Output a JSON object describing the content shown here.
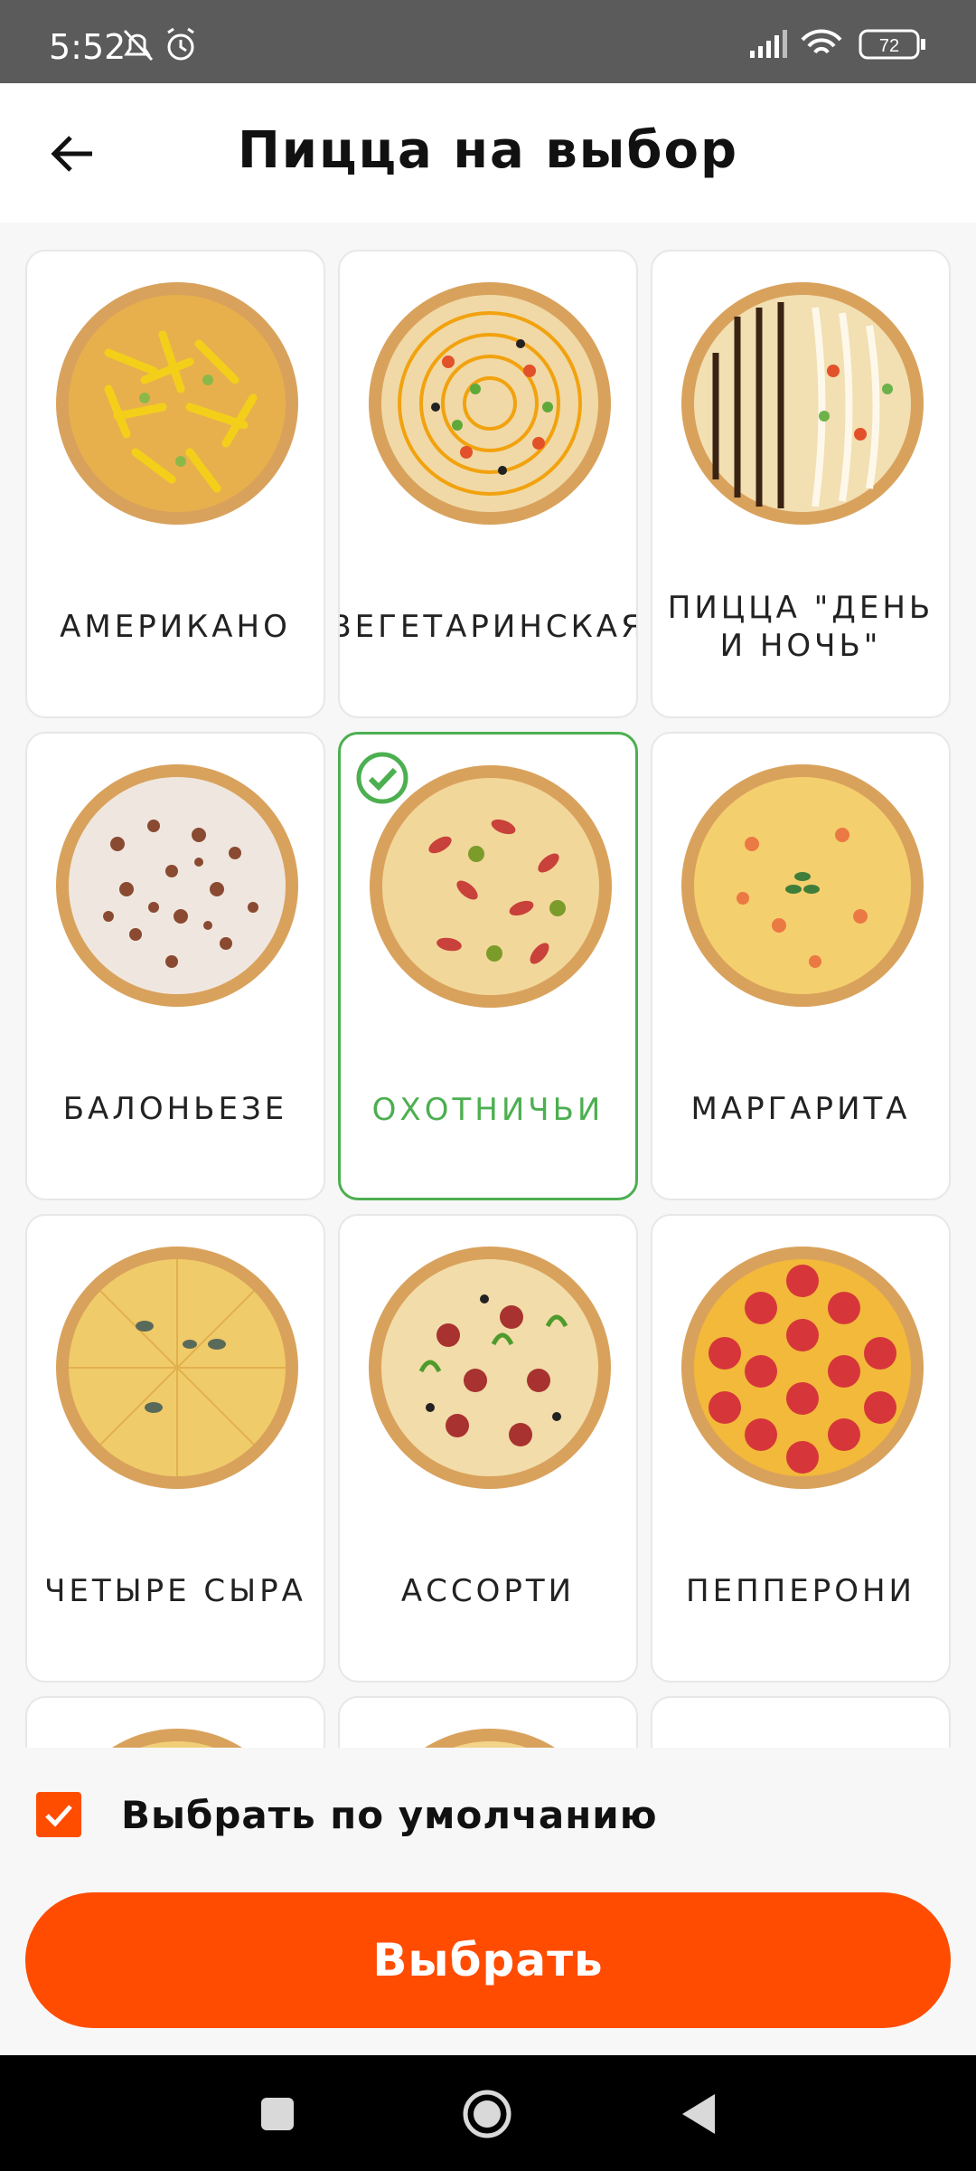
{
  "status_bar": {
    "time": "5:52",
    "battery": "72",
    "icons": [
      "notifications-off-icon",
      "alarm-icon",
      "signal-icon",
      "wifi-icon",
      "battery-icon"
    ]
  },
  "app_bar": {
    "title": "Пицца на выбор",
    "back_icon": "arrow-back-icon"
  },
  "pizzas": [
    {
      "label": "АМЕРИКАНО",
      "selected": false
    },
    {
      "label": "ВЕГЕТАРИНСКАЯ",
      "selected": false
    },
    {
      "label": "ПИЦЦА \"ДЕНЬ И НОЧЬ\"",
      "selected": false
    },
    {
      "label": "БАЛОНЬЕЗЕ",
      "selected": false
    },
    {
      "label": "ОХОТНИЧЬИ",
      "selected": true
    },
    {
      "label": "МАРГАРИТА",
      "selected": false
    },
    {
      "label": "ЧЕТЫРЕ СЫРА",
      "selected": false
    },
    {
      "label": "АССОРТИ",
      "selected": false
    },
    {
      "label": "ПЕППЕРОНИ",
      "selected": false
    },
    {
      "label": "",
      "selected": false
    },
    {
      "label": "",
      "selected": false
    },
    {
      "label": "",
      "selected": false
    }
  ],
  "default_option": {
    "label": "Выбрать по умолчанию",
    "checked": true
  },
  "primary_button": {
    "label": "Выбрать"
  },
  "colors": {
    "accent": "#ff4c00",
    "selected": "#4caf50",
    "status_bar": "#5b5b5b"
  },
  "nav_bar": {
    "icons": [
      "recents-icon",
      "home-icon",
      "back-icon"
    ]
  }
}
